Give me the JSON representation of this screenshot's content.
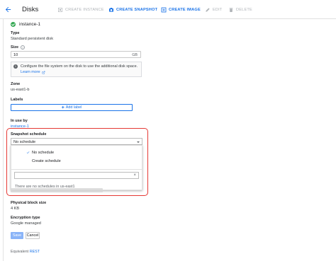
{
  "header": {
    "title": "Disks",
    "actions": {
      "create_instance": "CREATE INSTANCE",
      "create_snapshot": "CREATE SNAPSHOT",
      "create_image": "CREATE IMAGE",
      "edit": "EDIT",
      "delete": "DELETE"
    }
  },
  "disk": {
    "name": "instance-1",
    "type_label": "Type",
    "type_value": "Standard persistent disk",
    "size_label": "Size",
    "size_value": "10",
    "size_unit": "GB",
    "info_text": "Configure the file system on the disk to use the additional disk space.",
    "info_link": "Learn more",
    "zone_label": "Zone",
    "zone_value": "us-east1-b",
    "labels_label": "Labels",
    "add_label": "Add label",
    "in_use_label": "In use by",
    "in_use_value": "instance-1"
  },
  "snapshot": {
    "label": "Snapshot schedule",
    "selected": "No schedule",
    "options": [
      "No schedule",
      "Create schedule"
    ],
    "filter_value": "",
    "empty_text": "There are no schedules in us-east1"
  },
  "details": {
    "block_size_label": "Physical block size",
    "block_size_value": "4 KB",
    "encryption_label": "Encryption type",
    "encryption_value": "Google managed"
  },
  "footer": {
    "save": "Save",
    "cancel": "Cancel",
    "equivalent_prefix": "Equivalent",
    "equivalent_link": "REST"
  },
  "colors": {
    "accent": "#1a73e8",
    "success": "#34a853",
    "annotation": "#e53935",
    "disabled": "#b0b4b8"
  }
}
